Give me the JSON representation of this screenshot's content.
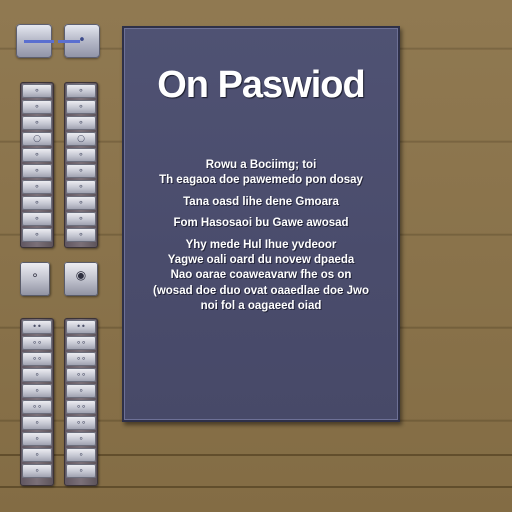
{
  "dialog": {
    "title": "On Paswiod",
    "lines": [
      "Rowu a Bociimg; toi",
      "Th eagaoa doe pawemedo pon dosay",
      "Tana oasd lihe dene Gmoara",
      "Fom Hasosaoi bu Gawe awosad",
      "Yhy mede Hul Ihue yvdeoor",
      "Yagwe oali oard du novew dpaeda",
      "Nao oarae coaweavarw fhe os on",
      "(wosad doe duo ovat oaaedlae doe Jwo",
      "noi fol a oagaeed oiad"
    ]
  },
  "toolbar": {
    "left_glyph": "—",
    "right_glyph": "•"
  },
  "keypad_upper_left": [
    "∘",
    "∘",
    "∘",
    "○",
    "∘",
    "∘",
    "∘",
    "∘",
    "∘",
    "∘"
  ],
  "keypad_upper_right": [
    "∘",
    "∘",
    "∘",
    "○",
    "∘",
    "∘",
    "∘",
    "∘",
    "∘",
    "∘"
  ],
  "mid_buttons": {
    "left_glyph": "∘",
    "right_glyph": "◉"
  },
  "keypad_lower_left": [
    "••",
    "∘∘",
    "∘∘",
    "∘",
    "∘",
    "∘∘",
    "∘",
    "∘",
    "∘",
    "∘"
  ],
  "keypad_lower_right": [
    "••",
    "∘∘",
    "∘∘",
    "∘∘",
    "∘",
    "∘∘",
    "∘∘",
    "∘",
    "∘",
    "∘"
  ]
}
